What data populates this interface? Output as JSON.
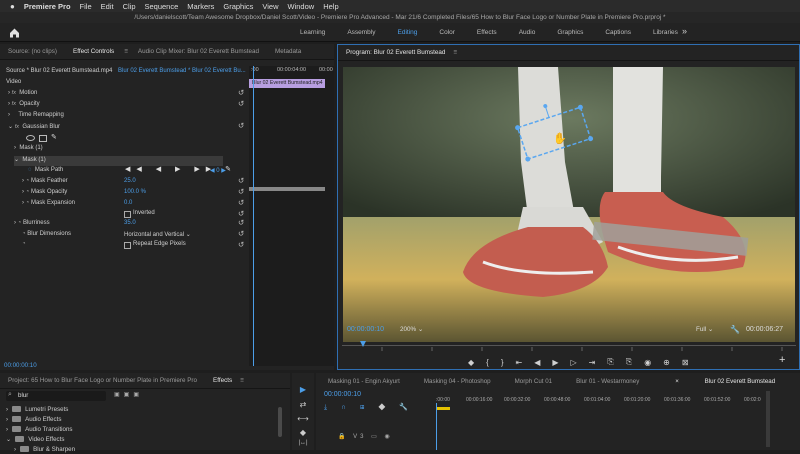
{
  "menubar": {
    "apple": "",
    "app_name": "Premiere Pro",
    "items": [
      "File",
      "Edit",
      "Clip",
      "Sequence",
      "Markers",
      "Graphics",
      "View",
      "Window",
      "Help"
    ]
  },
  "window_title": "/Users/danielscott/Team Awesome Dropbox/Daniel Scott/Video - Premiere Pro Advanced - Mar 21/6 Completed Files/65 How to Blur Face Logo or Number Plate in Premiere Pro.prproj *",
  "workspaces": {
    "home_icon": "home-icon",
    "tabs": [
      "Learning",
      "Assembly",
      "Editing",
      "Color",
      "Effects",
      "Audio",
      "Graphics",
      "Captions",
      "Libraries"
    ],
    "active": "Editing",
    "more_label": "»"
  },
  "effect_controls": {
    "tabs": [
      "Source: (no clips)",
      "Effect Controls",
      "Audio Clip Mixer: Blur 02 Everett Bumstead",
      "Metadata"
    ],
    "active_tab": "Effect Controls",
    "menu_icon": "≡",
    "source_label": "Source * Blur 02 Everett Bumstead.mp4",
    "target_label": "Blur 02 Everett Bumstead * Blur 02 Everett Bu...",
    "timecodes": [
      ":00",
      "00:00:04:00",
      "00:00"
    ],
    "clip_label": "Blur 02 Everett Bumstead.mp4",
    "video_header": "Video",
    "properties": {
      "motion": "Motion",
      "opacity": "Opacity",
      "time_remapping": "Time Remapping",
      "gaussian_blur": "Gaussian Blur",
      "mask_1_a": "Mask (1)",
      "mask_1_b": "Mask (1)",
      "mask_path": "Mask Path",
      "mask_feather": "Mask Feather",
      "mask_feather_value": "25.0",
      "mask_opacity": "Mask Opacity",
      "mask_opacity_value": "100.0 %",
      "mask_expansion": "Mask Expansion",
      "mask_expansion_value": "0.0",
      "inverted": "Inverted",
      "blurriness": "Blurriness",
      "blurriness_value": "35.0",
      "blur_dimensions": "Blur Dimensions",
      "blur_dimensions_value": "Horizontal and Vertical",
      "repeat_edge": "Repeat Edge Pixels",
      "fx": "fx",
      "path_value": "0"
    },
    "current_time": "00:00:00:10"
  },
  "program_monitor": {
    "title": "Program: Blur 02 Everett Bumstead",
    "menu_icon": "≡",
    "timecode": "00:00:00:10",
    "zoom": "200%",
    "quality": "Full",
    "duration": "00:00:06:27",
    "controls": [
      "◆",
      "{",
      "}",
      "⇤",
      "◀",
      "▶",
      "▷",
      "⇥",
      "⎘",
      "⎘",
      "◉",
      "⊕",
      "⊠"
    ],
    "add_icon": "+"
  },
  "project": {
    "tabs": [
      "Project: 65 How to Blur Face Logo or Number Plate in Premiere Pro",
      "Effects"
    ],
    "active_tab": "Effects",
    "search_value": "blur",
    "tree": [
      "Lumetri Presets",
      "Audio Effects",
      "Audio Transitions",
      "Video Effects",
      "Blur & Sharpen"
    ]
  },
  "tools": [
    "▶",
    "⇄",
    "⟷",
    "◆",
    "|↔|"
  ],
  "timeline": {
    "tabs": [
      "Masking 01 - Engin Akyurt",
      "Masking 04 - Photoshop",
      "Morph Cut 01",
      "Blur 01 - Westarmoney",
      "Blur 02 Everett Bumstead"
    ],
    "active_tab": "Blur 02 Everett Bumstead",
    "close_icon": "×",
    "timecode": "00:00:00:10",
    "ruler": [
      ":00:00",
      "00:00:16:00",
      "00:00:32:00",
      "00:00:48:00",
      "00:01:04:00",
      "00:01:20:00",
      "00:01:36:00",
      "00:01:52:00",
      "00:02:0"
    ],
    "track_label": "V3"
  }
}
